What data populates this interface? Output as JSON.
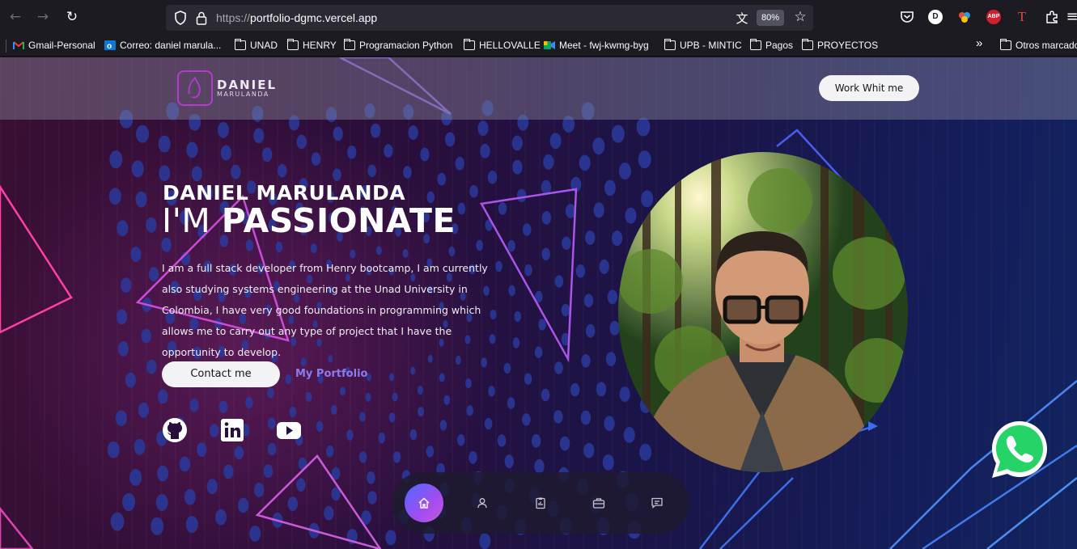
{
  "browser": {
    "url_scheme": "https://",
    "url_host": "portfolio-dgmc.vercel.app",
    "zoom": "80%",
    "extensions": [
      "D",
      "ABP",
      "T"
    ]
  },
  "bookmarks": [
    {
      "label": "Gmail-Personal",
      "icon": "gmail-icon"
    },
    {
      "label": "Correo: daniel marula...",
      "icon": "outlook-icon"
    },
    {
      "label": "UNAD",
      "icon": "folder-icon"
    },
    {
      "label": "HENRY",
      "icon": "folder-icon"
    },
    {
      "label": "Programacion Python",
      "icon": "folder-icon"
    },
    {
      "label": "HELLOVALLE",
      "icon": "folder-icon"
    },
    {
      "label": "Meet - fwj-kwmg-byg",
      "icon": "meet-icon"
    },
    {
      "label": "UPB - MINTIC",
      "icon": "folder-icon"
    },
    {
      "label": "Pagos",
      "icon": "folder-icon"
    },
    {
      "label": "PROYECTOS",
      "icon": "folder-icon"
    },
    {
      "label": "Otros marcado",
      "icon": "folder-icon"
    }
  ],
  "site": {
    "logo_name": "DANIEL",
    "logo_sub": "MARULANDA",
    "work_button": "Work Whit me",
    "hero_name": "DANIEL MARULANDA",
    "hero_title_prefix": "I'M ",
    "hero_title_word": "PASSIONATE",
    "description": "I am a full stack developer from Henry bootcamp, I am currently also studying systems engineering at the Unad University in Colombia, I have very good foundations in programming which allows me to carry out any type of project that I have the opportunity to develop.",
    "contact_button": "Contact me",
    "portfolio_link": "My Portfolio",
    "socials": [
      "github-icon",
      "linkedin-icon",
      "youtube-icon"
    ],
    "dock": [
      "home-icon",
      "user-icon",
      "clipboard-icon",
      "briefcase-icon",
      "chat-icon"
    ]
  },
  "colors": {
    "accent": "#8a7cf0",
    "dock_active_start": "#4b6bff",
    "dock_active_end": "#c75bd8",
    "whatsapp": "#25d366"
  }
}
